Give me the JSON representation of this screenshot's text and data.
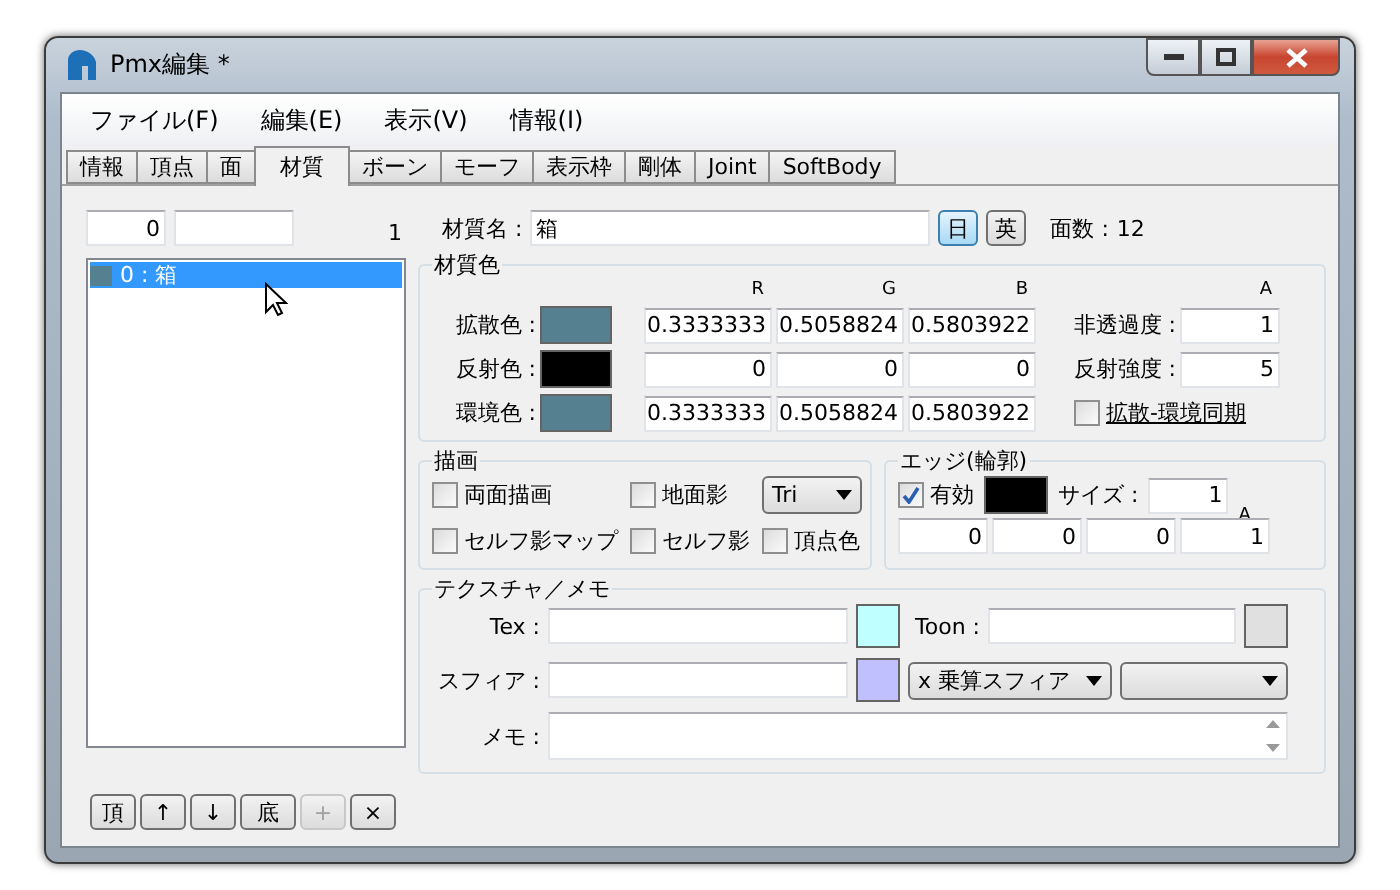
{
  "window": {
    "title": "Pmx編集 *"
  },
  "menu": [
    {
      "label": "ファイル(F)"
    },
    {
      "label": "編集(E)"
    },
    {
      "label": "表示(V)"
    },
    {
      "label": "情報(I)"
    }
  ],
  "tabs": [
    {
      "label": "情報",
      "selected": false
    },
    {
      "label": "頂点",
      "selected": false
    },
    {
      "label": "面",
      "selected": false
    },
    {
      "label": "材質",
      "selected": true
    },
    {
      "label": "ボーン",
      "selected": false
    },
    {
      "label": "モーフ",
      "selected": false
    },
    {
      "label": "表示枠",
      "selected": false
    },
    {
      "label": "剛体",
      "selected": false
    },
    {
      "label": "Joint",
      "selected": false
    },
    {
      "label": "SoftBody",
      "selected": false
    }
  ],
  "material_list": {
    "index": "0",
    "count": "1",
    "items": [
      {
        "label": "0 : 箱",
        "color": "#55808f",
        "selected": true
      }
    ]
  },
  "list_buttons": [
    {
      "label": "頂",
      "disabled": false
    },
    {
      "label": "↑",
      "disabled": false
    },
    {
      "label": "↓",
      "disabled": false
    },
    {
      "label": "底",
      "disabled": false
    },
    {
      "label": "+",
      "disabled": true
    },
    {
      "label": "×",
      "disabled": false
    }
  ],
  "material_name": {
    "label": "材質名 :",
    "value": "箱"
  },
  "language_buttons": [
    {
      "label": "日",
      "selected": true
    },
    {
      "label": "英",
      "selected": false
    }
  ],
  "face_count": {
    "label": "面数 :",
    "value": "12"
  },
  "material_color": {
    "title": "材質色",
    "headers": [
      "R",
      "G",
      "B"
    ],
    "alpha_header": "A",
    "rows": [
      {
        "label": "拡散色 :",
        "color": "#55808f",
        "values": [
          "0.3333333",
          "0.5058824",
          "0.5803922"
        ]
      },
      {
        "label": "反射色 :",
        "color": "#000000",
        "values": [
          "0",
          "0",
          "0"
        ]
      },
      {
        "label": "環境色 :",
        "color": "#55808f",
        "values": [
          "0.3333333",
          "0.5058824",
          "0.5803922"
        ]
      }
    ],
    "extras": [
      {
        "label": "非透過度 :",
        "value": "1"
      },
      {
        "label": "反射強度 :",
        "value": "5"
      }
    ],
    "sync": {
      "label": "拡散-環境同期",
      "checked": false
    }
  },
  "drawing": {
    "title": "描画",
    "options": [
      {
        "label": "両面描画",
        "checked": false
      },
      {
        "label": "地面影",
        "checked": false
      },
      {
        "label": "セルフ影マップ",
        "checked": false
      },
      {
        "label": "セルフ影",
        "checked": false
      },
      {
        "label": "頂点色",
        "checked": false
      }
    ],
    "primitive": "Tri"
  },
  "edge": {
    "title": "エッジ(輪郭)",
    "enabled": {
      "label": "有効",
      "checked": true
    },
    "color": "#000000",
    "size_label": "サイズ :",
    "size": "1",
    "alpha_header": "A",
    "rgba": [
      "0",
      "0",
      "0",
      "1"
    ]
  },
  "texture": {
    "title": "テクスチャ／メモ",
    "slots": [
      {
        "label": "Tex :",
        "color": "#c0ffff"
      },
      {
        "label": "Toon :",
        "color": "#e0e0e0"
      },
      {
        "label": "スフィア :",
        "color": "#c0c0ff"
      }
    ],
    "sphere_mode": "x 乗算スフィア",
    "memo_label": "メモ :"
  }
}
